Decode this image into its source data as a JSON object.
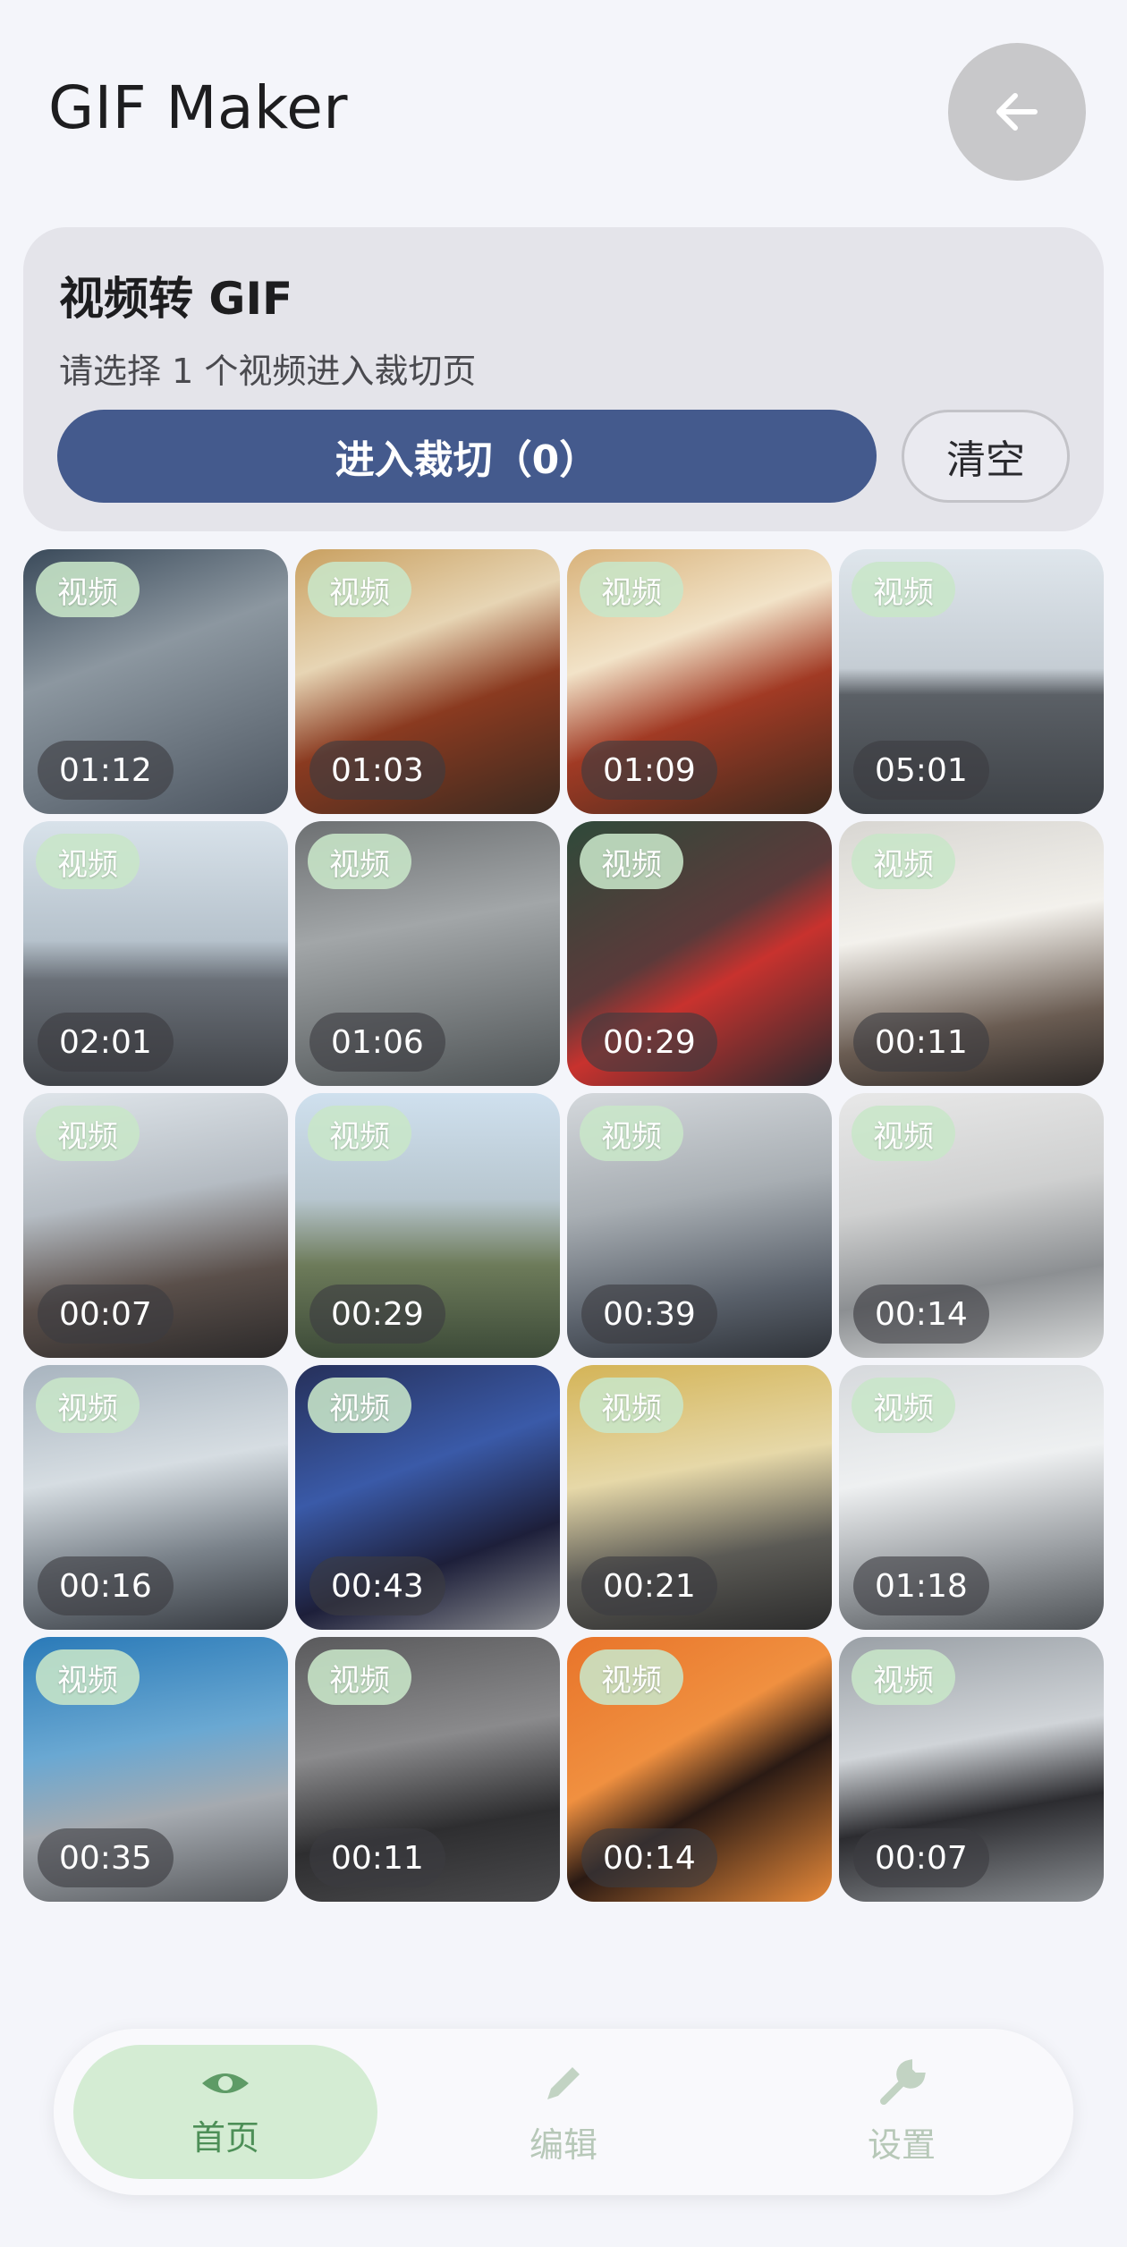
{
  "header": {
    "title": "GIF Maker",
    "back_icon": "arrow-left-icon"
  },
  "card": {
    "title": "视频转 GIF",
    "subtitle": "请选择 1 个视频进入裁切页",
    "crop_button": "进入裁切（0）",
    "clear_button": "清空"
  },
  "badge_label": "视频",
  "videos": [
    {
      "duration": "01:12"
    },
    {
      "duration": "01:03"
    },
    {
      "duration": "01:09"
    },
    {
      "duration": "05:01"
    },
    {
      "duration": "02:01"
    },
    {
      "duration": "01:06"
    },
    {
      "duration": "00:29"
    },
    {
      "duration": "00:11"
    },
    {
      "duration": "00:07"
    },
    {
      "duration": "00:29"
    },
    {
      "duration": "00:39"
    },
    {
      "duration": "00:14"
    },
    {
      "duration": "00:16"
    },
    {
      "duration": "00:43"
    },
    {
      "duration": "00:21"
    },
    {
      "duration": "01:18"
    },
    {
      "duration": "00:35"
    },
    {
      "duration": "00:11"
    },
    {
      "duration": "00:14"
    },
    {
      "duration": "00:07"
    }
  ],
  "nav": {
    "items": [
      {
        "label": "首页",
        "icon": "eye-icon",
        "active": true
      },
      {
        "label": "编辑",
        "icon": "pen-icon",
        "active": false
      },
      {
        "label": "设置",
        "icon": "wrench-icon",
        "active": false
      }
    ]
  },
  "colors": {
    "primary": "#445a8d",
    "badge": "#c8e6c8",
    "nav_active": "#d4ecd3",
    "nav_active_text": "#4d8f57"
  }
}
